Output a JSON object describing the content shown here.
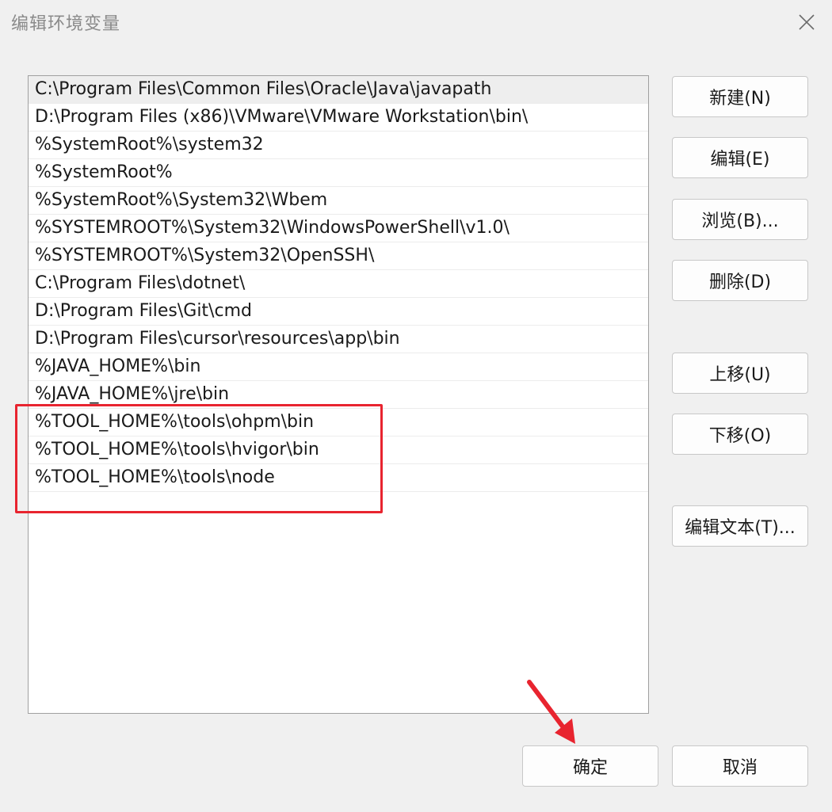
{
  "window": {
    "title": "编辑环境变量",
    "close_icon": "close-icon"
  },
  "path_list": {
    "items": [
      "C:\\Program Files\\Common Files\\Oracle\\Java\\javapath",
      "D:\\Program Files (x86)\\VMware\\VMware Workstation\\bin\\",
      "%SystemRoot%\\system32",
      "%SystemRoot%",
      "%SystemRoot%\\System32\\Wbem",
      "%SYSTEMROOT%\\System32\\WindowsPowerShell\\v1.0\\",
      "%SYSTEMROOT%\\System32\\OpenSSH\\",
      "C:\\Program Files\\dotnet\\",
      "D:\\Program Files\\Git\\cmd",
      "D:\\Program Files\\cursor\\resources\\app\\bin",
      "%JAVA_HOME%\\bin",
      "%JAVA_HOME%\\jre\\bin",
      "%TOOL_HOME%\\tools\\ohpm\\bin",
      "%TOOL_HOME%\\tools\\hvigor\\bin",
      "%TOOL_HOME%\\tools\\node"
    ],
    "selected_index": 0
  },
  "buttons": {
    "new": "新建(N)",
    "edit": "编辑(E)",
    "browse": "浏览(B)...",
    "delete": "删除(D)",
    "move_up": "上移(U)",
    "move_down": "下移(O)",
    "edit_text": "编辑文本(T)...",
    "ok": "确定",
    "cancel": "取消"
  },
  "annotations": {
    "highlight_color": "#e8242f",
    "arrow_color": "#e8242f"
  }
}
